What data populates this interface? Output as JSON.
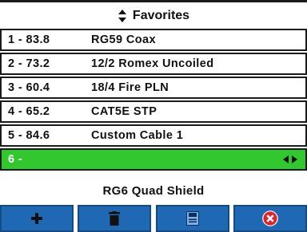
{
  "header": {
    "title": "Favorites",
    "icon": "sort-updown-icon"
  },
  "favorites": [
    {
      "number": "1 - 83.8",
      "name": "RG59 Coax"
    },
    {
      "number": "2 - 73.2",
      "name": "12/2 Romex Uncoiled"
    },
    {
      "number": "3 - 60.4",
      "name": "18/4 Fire PLN"
    },
    {
      "number": "4 - 65.2",
      "name": "CAT5E STP"
    },
    {
      "number": "5 - 84.6",
      "name": "Custom Cable 1"
    },
    {
      "number": "6 -",
      "name": ""
    }
  ],
  "selected_index": 5,
  "selected_cable_name": "RG6 Quad Shield",
  "toolbar": {
    "buttons": [
      {
        "icon": "plus-icon"
      },
      {
        "icon": "trash-icon"
      },
      {
        "icon": "save-icon"
      },
      {
        "icon": "cancel-icon"
      }
    ]
  },
  "colors": {
    "selected_row": "#32c72f",
    "toolbar_button": "#1f68b4",
    "cancel_red": "#e0212b"
  }
}
